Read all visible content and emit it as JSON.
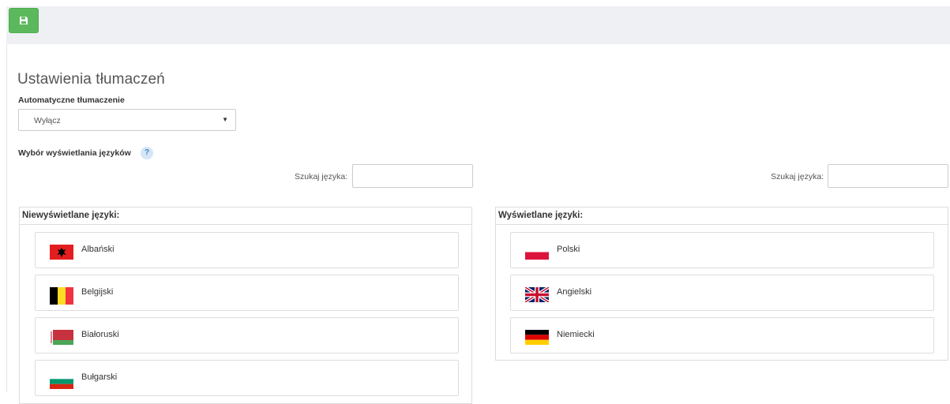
{
  "toolbar": {
    "save_icon": "floppy-disk-icon",
    "accent": "#5cb85c"
  },
  "page": {
    "title": "Ustawienia tłumaczeń"
  },
  "auto_translate": {
    "label": "Automatyczne tłumaczenie",
    "selected": "Wyłącz"
  },
  "language_display": {
    "label": "Wybór wyświetlania języków",
    "help": "?"
  },
  "search": {
    "label": "Szukaj języka:",
    "value": ""
  },
  "hidden_languages": {
    "header": "Niewyświetlane języki:",
    "items": [
      {
        "name": "Albański",
        "flag": "albania"
      },
      {
        "name": "Belgijski",
        "flag": "belgium"
      },
      {
        "name": "Białoruski",
        "flag": "belarus"
      },
      {
        "name": "Bułgarski",
        "flag": "bulgaria"
      }
    ]
  },
  "shown_languages": {
    "header": "Wyświetlane języki:",
    "items": [
      {
        "name": "Polski",
        "flag": "poland"
      },
      {
        "name": "Angielski",
        "flag": "united-kingdom"
      },
      {
        "name": "Niemiecki",
        "flag": "germany"
      }
    ]
  }
}
